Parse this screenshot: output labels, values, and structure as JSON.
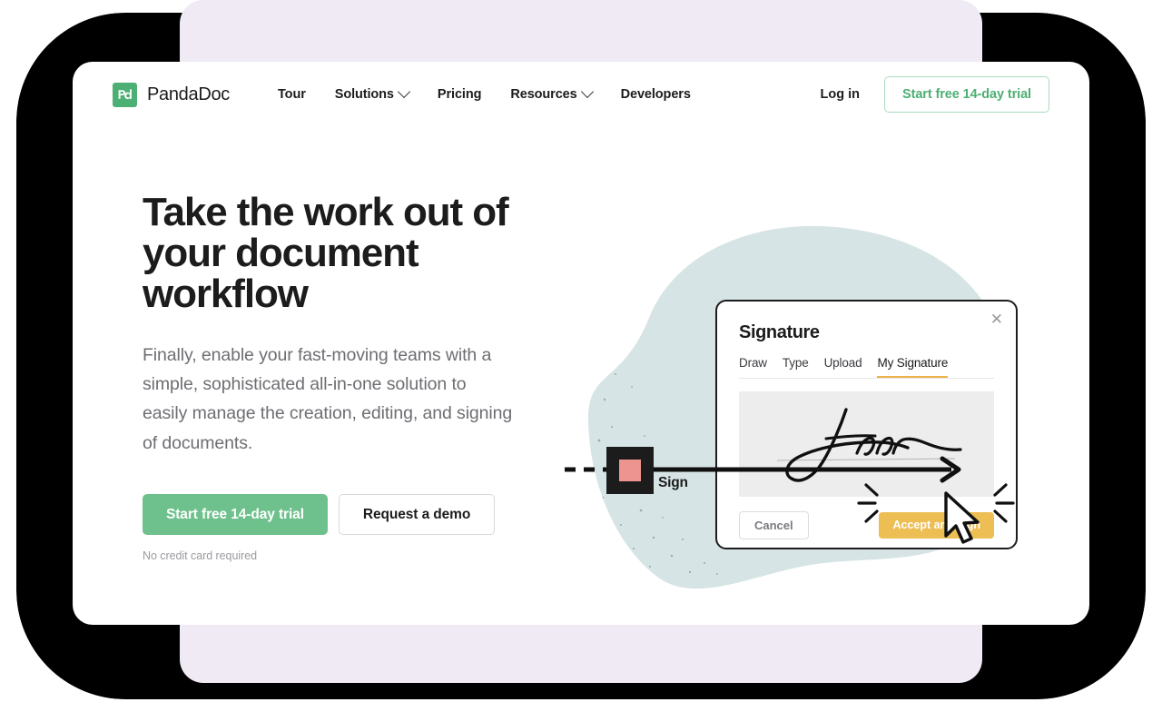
{
  "brand": {
    "name": "PandaDoc",
    "logo_icon": "pandadoc-pd-logo-icon",
    "logo_color": "#4CAF73"
  },
  "header": {
    "nav": [
      {
        "label": "Tour",
        "has_caret": false
      },
      {
        "label": "Solutions",
        "has_caret": true
      },
      {
        "label": "Pricing",
        "has_caret": false
      },
      {
        "label": "Resources",
        "has_caret": true
      },
      {
        "label": "Developers",
        "has_caret": false
      }
    ],
    "login_label": "Log in",
    "cta_label": "Start free 14-day trial",
    "cta_color": "#4CAF73"
  },
  "hero": {
    "title": "Take the work out of your document workflow",
    "subtitle": "Finally, enable your fast-moving teams with a simple, sophisticated all-in-one solution to easily manage the creation, editing, and signing of documents.",
    "primary_cta": "Start free 14-day trial",
    "secondary_cta": "Request a demo",
    "note": "No credit card required",
    "primary_color": "#6EC18C"
  },
  "illustration": {
    "blob_color": "#D7E4E5",
    "signature_modal": {
      "title": "Signature",
      "close_icon": "close-icon",
      "tabs": [
        {
          "label": "Draw",
          "active": false
        },
        {
          "label": "Type",
          "active": false
        },
        {
          "label": "Upload",
          "active": false
        },
        {
          "label": "My Signature",
          "active": true
        }
      ],
      "active_tab_color": "#EDB44A",
      "signature_preview": "handwritten-signature",
      "cancel_label": "Cancel",
      "accept_label": "Accept and sign",
      "accept_color": "#EDBE54"
    },
    "timeline": {
      "step_label": "Sign",
      "marker_inner_color": "#EE9490",
      "marker_outer_color": "#1C1C1C"
    },
    "cursor_icon": "mouse-pointer-icon"
  }
}
